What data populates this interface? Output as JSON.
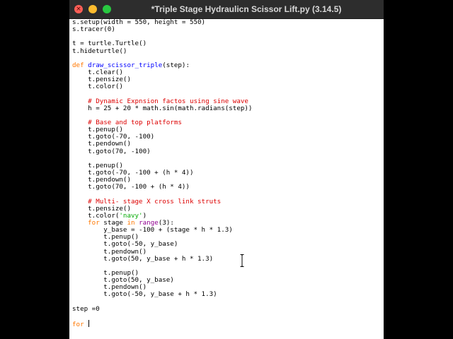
{
  "window": {
    "title": "*Triple Stage Hydraulicn Scissor Lift.py (3.14.5)",
    "buttons": {
      "close": "close",
      "minimize": "minimize",
      "zoom": "zoom"
    }
  },
  "colors": {
    "keyword": "#ff7700",
    "definition": "#0000ff",
    "comment": "#dd0000",
    "string": "#00aa00",
    "builtin": "#900090",
    "text": "#000000"
  },
  "code_lines": [
    [
      {
        "t": "s.setup(width = 550, height = 550)"
      }
    ],
    [
      {
        "t": "s.tracer(0)"
      }
    ],
    [],
    [
      {
        "t": "t = turtle.Turtle()"
      }
    ],
    [
      {
        "t": "t.hideturtle()"
      }
    ],
    [],
    [
      {
        "t": "def",
        "c": "kw"
      },
      {
        "t": " "
      },
      {
        "t": "draw_scissor_triple",
        "c": "def"
      },
      {
        "t": "(step):"
      }
    ],
    [
      {
        "t": "    t.clear()"
      }
    ],
    [
      {
        "t": "    t.pensize()"
      }
    ],
    [
      {
        "t": "    t.color()"
      }
    ],
    [],
    [
      {
        "t": "    "
      },
      {
        "t": "# Dynamic Expnsion factos using sine wave",
        "c": "cmt"
      }
    ],
    [
      {
        "t": "    h = 25 + 20 * math.sin(math.radians(step))"
      }
    ],
    [],
    [
      {
        "t": "    "
      },
      {
        "t": "# Base and top platforms",
        "c": "cmt"
      }
    ],
    [
      {
        "t": "    t.penup()"
      }
    ],
    [
      {
        "t": "    t.goto(-70, -100)"
      }
    ],
    [
      {
        "t": "    t.pendown()"
      }
    ],
    [
      {
        "t": "    t.goto(70, -100)"
      }
    ],
    [],
    [
      {
        "t": "    t.penup()"
      }
    ],
    [
      {
        "t": "    t.goto(-70, -100 + (h * 4))"
      }
    ],
    [
      {
        "t": "    t.pendown()"
      }
    ],
    [
      {
        "t": "    t.goto(70, -100 + (h * 4))"
      }
    ],
    [],
    [
      {
        "t": "    "
      },
      {
        "t": "# Multi- stage X cross link struts",
        "c": "cmt"
      }
    ],
    [
      {
        "t": "    t.pensize()"
      }
    ],
    [
      {
        "t": "    t.color("
      },
      {
        "t": "'navy'",
        "c": "str"
      },
      {
        "t": ")"
      }
    ],
    [
      {
        "t": "    "
      },
      {
        "t": "for",
        "c": "kw"
      },
      {
        "t": " stage "
      },
      {
        "t": "in",
        "c": "kw"
      },
      {
        "t": " "
      },
      {
        "t": "range",
        "c": "bi"
      },
      {
        "t": "(3):"
      }
    ],
    [
      {
        "t": "        y_base = -100 + (stage * h * 1.3)"
      }
    ],
    [
      {
        "t": "        t.penup()"
      }
    ],
    [
      {
        "t": "        t.goto(-50, y_base)"
      }
    ],
    [
      {
        "t": "        t.pendown()"
      }
    ],
    [
      {
        "t": "        t.goto(50, y_base + h * 1.3)"
      }
    ],
    [],
    [
      {
        "t": "        t.penup()"
      }
    ],
    [
      {
        "t": "        t.goto(50, y_base)"
      }
    ],
    [
      {
        "t": "        t.pendown()"
      }
    ],
    [
      {
        "t": "        t.goto(-50, y_base + h * 1.3)"
      }
    ],
    [],
    [
      {
        "t": "step =0"
      }
    ],
    [],
    [
      {
        "t": "for",
        "c": "kw"
      },
      {
        "t": " "
      }
    ]
  ]
}
